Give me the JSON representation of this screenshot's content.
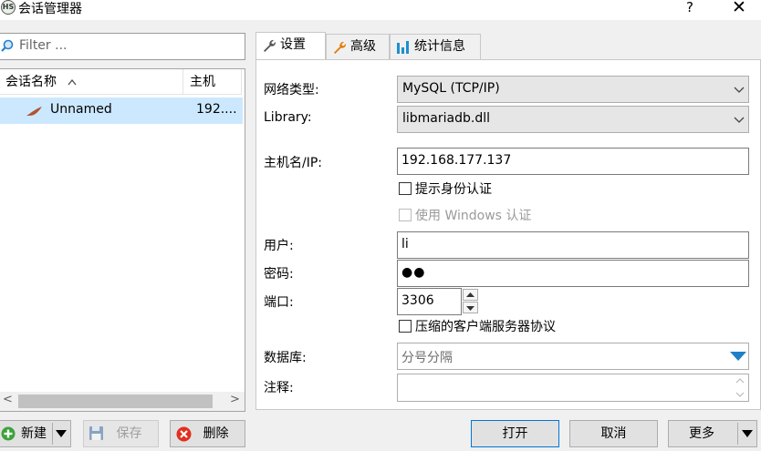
{
  "window": {
    "title": "会话管理器",
    "app_icon_text": "HS",
    "help_label": "?",
    "close_label": "✕"
  },
  "filter": {
    "placeholder": "Filter ..."
  },
  "list": {
    "columns": [
      {
        "label": "会话名称",
        "sort_indicator": "^"
      },
      {
        "label": "主机"
      }
    ],
    "rows": [
      {
        "name": "Unnamed",
        "host": "192...."
      }
    ],
    "scroll_left": "<",
    "scroll_right": ">"
  },
  "tabs": [
    {
      "label": "设置",
      "icon": "wrench-icon"
    },
    {
      "label": "高级",
      "icon": "wrench-orange-icon"
    },
    {
      "label": "统计信息",
      "icon": "bar-chart-icon"
    }
  ],
  "settings": {
    "network_type": {
      "label": "网络类型:",
      "value": "MySQL (TCP/IP)"
    },
    "library": {
      "label": "Library:",
      "value": "libmariadb.dll"
    },
    "host": {
      "label": "主机名/IP:",
      "value": "192.168.177.137"
    },
    "prompt_auth": {
      "label": "提示身份认证",
      "checked": false
    },
    "windows_auth": {
      "label": "使用 Windows 认证",
      "checked": false,
      "disabled": true
    },
    "user": {
      "label": "用户:",
      "value": "li"
    },
    "password": {
      "label": "密码:",
      "value": "●●"
    },
    "port": {
      "label": "端口:",
      "value": "3306"
    },
    "compress": {
      "label": "压缩的客户端服务器协议",
      "checked": false
    },
    "database": {
      "label": "数据库:",
      "placeholder": "分号分隔"
    },
    "comment": {
      "label": "注释:",
      "value": ""
    }
  },
  "buttons": {
    "new": "新建",
    "save": "保存",
    "delete": "删除",
    "open": "打开",
    "cancel": "取消",
    "more": "更多"
  },
  "colors": {
    "selection": "#cce8ff",
    "accent": "#0078d7",
    "tab_icon": "#ff8c00",
    "chart_icon": "#1e90c8"
  }
}
